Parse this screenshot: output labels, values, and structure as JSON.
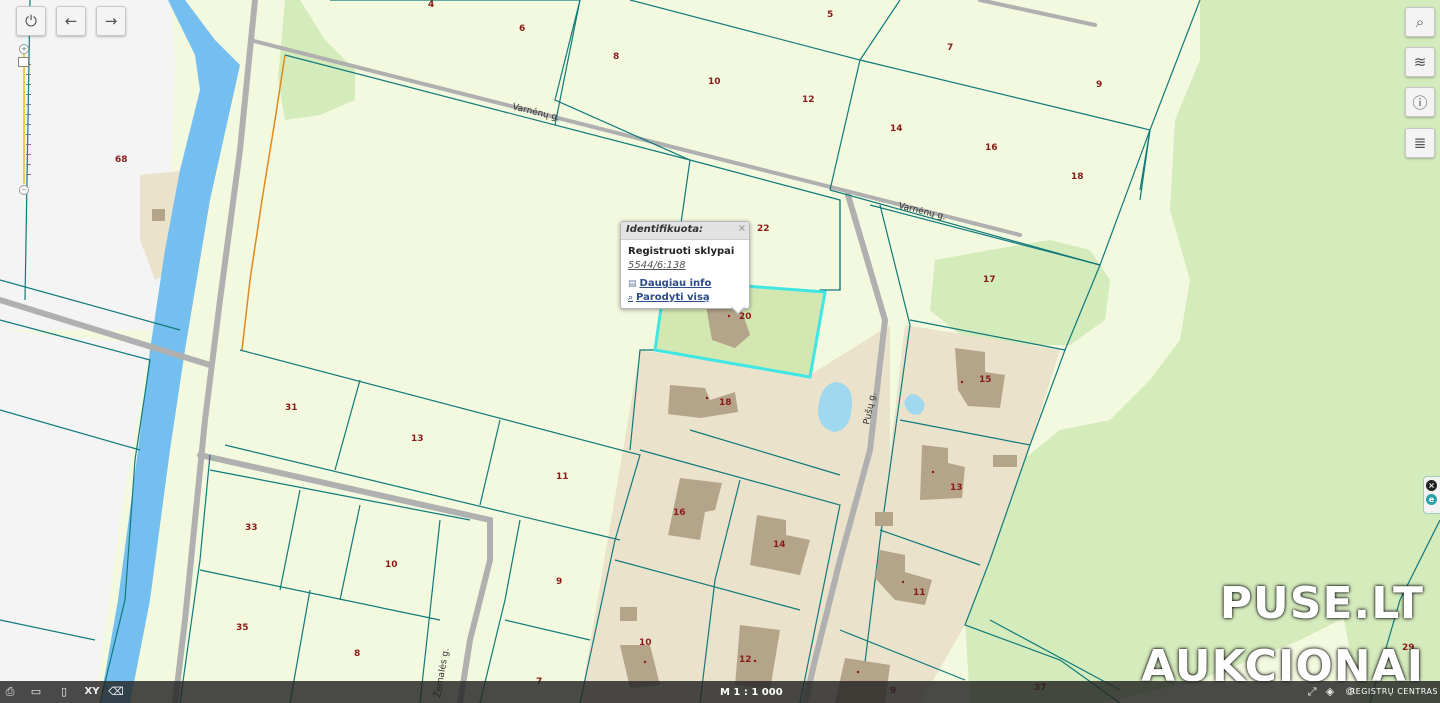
{
  "toolbar": {
    "power_icon": "power-icon",
    "back_icon": "arrow-left-icon",
    "forward_icon": "arrow-right-icon",
    "zoom_in_symbol": "+",
    "zoom_out_symbol": "−"
  },
  "right_tools": [
    {
      "icon": "search-icon",
      "glyph": "⌕"
    },
    {
      "icon": "layers-icon",
      "glyph": "≋"
    },
    {
      "icon": "info-icon",
      "glyph": "ⓘ"
    },
    {
      "icon": "legend-icon",
      "glyph": "≣"
    }
  ],
  "popup": {
    "title": "Identifikuota:",
    "close": "×",
    "layer": "Registruoti sklypai",
    "plot_id": "5544/6:138",
    "more_info": "Daugiau info",
    "show_all": "Parodyti visą"
  },
  "map": {
    "streets": [
      "Varnėnų g.",
      "Varnėnų g.",
      "Pušų g.",
      "Žemalės g."
    ],
    "plot_numbers": [
      "4",
      "6",
      "5",
      "7",
      "8",
      "10",
      "12",
      "9",
      "14",
      "16",
      "18",
      "68",
      "22",
      "17",
      "20",
      "15",
      "18",
      "31",
      "13",
      "11",
      "13",
      "16",
      "14",
      "33",
      "10",
      "9",
      "11",
      "35",
      "8",
      "10",
      "12",
      "7",
      "9",
      "37",
      "29"
    ],
    "colors": {
      "land": "#f2f9de",
      "forest": "#d4ebbc",
      "water": "#9fd8ef",
      "canal": "#74bff0",
      "plot_border": "#117a7a",
      "road": "#9a9a9a",
      "building": "#b4a58a",
      "yard": "#ebe2cb",
      "selected_border": "#3fe6e3",
      "selected_fill": "#d3e8b1",
      "label": "#8a1a1a"
    }
  },
  "watermark": {
    "line1": "PUSE.LT",
    "line2": "AUKCIONAI"
  },
  "bottom_bar": {
    "scale": "M 1 : 1 000",
    "logo_text": "REGISTRŲ CENTRAS",
    "icons": [
      "print-icon",
      "measure-icon",
      "document-icon",
      "coordinates-icon",
      "eraser-icon"
    ],
    "xy_label": "XY",
    "right_icons": [
      "fullscreen-icon",
      "map-icon",
      "copyright-icon"
    ]
  }
}
